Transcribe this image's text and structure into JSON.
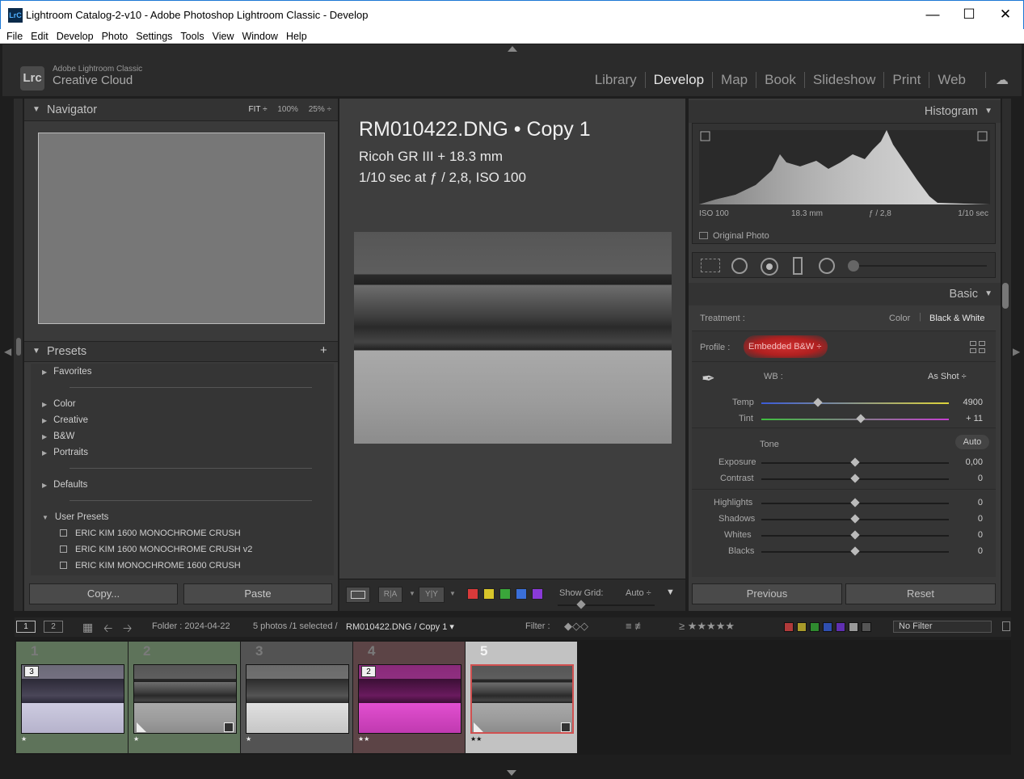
{
  "window": {
    "title": "Lightroom Catalog-2-v10 - Adobe Photoshop Lightroom Classic - Develop",
    "app_icon": "LrC"
  },
  "menu": [
    "File",
    "Edit",
    "Develop",
    "Photo",
    "Settings",
    "Tools",
    "View",
    "Window",
    "Help"
  ],
  "brand": {
    "line1": "Adobe Lightroom Classic",
    "line2": "Creative Cloud",
    "logo": "Lrc"
  },
  "modules": [
    "Library",
    "Develop",
    "Map",
    "Book",
    "Slideshow",
    "Print",
    "Web"
  ],
  "active_module": "Develop",
  "navigator": {
    "title": "Navigator",
    "fit": "FIT ÷",
    "z100": "100%",
    "z25": "25% ÷"
  },
  "presets": {
    "title": "Presets",
    "groups": [
      "Favorites",
      "Color",
      "Creative",
      "B&W",
      "Portraits",
      "Defaults",
      "User Presets"
    ],
    "user_items": [
      "ERIC KIM 1600 MONOCHROME CRUSH",
      "ERIC KIM 1600 MONOCHROME CRUSH v2",
      "ERIC KIM MONOCHROME 1600 CRUSH"
    ]
  },
  "left_buttons": {
    "copy": "Copy...",
    "paste": "Paste"
  },
  "photo_info": {
    "name": "RM010422.DNG  •  Copy 1",
    "camera": "Ricoh GR III + 18.3 mm",
    "exposure": "1/10 sec at ƒ / 2,8, ISO 100"
  },
  "toolbar": {
    "show_grid": "Show Grid:",
    "grid_value": "Auto ÷",
    "ra": "R|A",
    "yy": "Y|Y",
    "color_labels": [
      "#d93a3a",
      "#d8c62a",
      "#3aa63a",
      "#3a6fd8",
      "#8a3ad8"
    ]
  },
  "histogram": {
    "title": "Histogram",
    "iso": "ISO 100",
    "focal": "18.3 mm",
    "aperture": "ƒ / 2,8",
    "shutter": "1/10 sec",
    "original_photo": "Original Photo"
  },
  "basic": {
    "title": "Basic",
    "treatment_label": "Treatment :",
    "treatment_color": "Color",
    "treatment_bw": "Black & White",
    "profile_label": "Profile :",
    "profile_value": "Embedded B&W ÷",
    "wb_label": "WB :",
    "wb_value": "As Shot ÷",
    "tone_label": "Tone",
    "auto_label": "Auto",
    "sliders": [
      {
        "name": "Temp",
        "value": "4900",
        "pos": 0.3
      },
      {
        "name": "Tint",
        "value": "+ 11",
        "pos": 0.53
      },
      {
        "name": "Exposure",
        "value": "0,00",
        "pos": 0.5
      },
      {
        "name": "Contrast",
        "value": "0",
        "pos": 0.5
      },
      {
        "name": "Highlights",
        "value": "0",
        "pos": 0.5
      },
      {
        "name": "Shadows",
        "value": "0",
        "pos": 0.5
      },
      {
        "name": "Whites",
        "value": "0",
        "pos": 0.5
      },
      {
        "name": "Blacks",
        "value": "0",
        "pos": 0.5
      }
    ]
  },
  "right_buttons": {
    "previous": "Previous",
    "reset": "Reset"
  },
  "filmstrip_bar": {
    "page1": "1",
    "page2": "2",
    "folder": "Folder : 2024-04-22",
    "count": "5 photos /1 selected /",
    "file": "RM010422.DNG / Copy 1 ▾",
    "filter_label": "Filter :",
    "rating_filter": "≥ ★★★★★",
    "no_filter": "No Filter"
  },
  "filmstrip": [
    {
      "num": "1",
      "badge": "3",
      "stars": "★",
      "bg": "#5e735a",
      "tint": "lavender"
    },
    {
      "num": "2",
      "badge": "",
      "stars": "★",
      "bg": "#5e735a",
      "tint": "gray"
    },
    {
      "num": "3",
      "badge": "",
      "stars": "★",
      "bg": "#535353",
      "tint": "gray"
    },
    {
      "num": "4",
      "badge": "2",
      "stars": "★★",
      "bg": "#5c4446",
      "tint": "magenta"
    },
    {
      "num": "5",
      "badge": "",
      "stars": "★★",
      "bg": "#c2c2c2",
      "tint": "dark"
    }
  ]
}
